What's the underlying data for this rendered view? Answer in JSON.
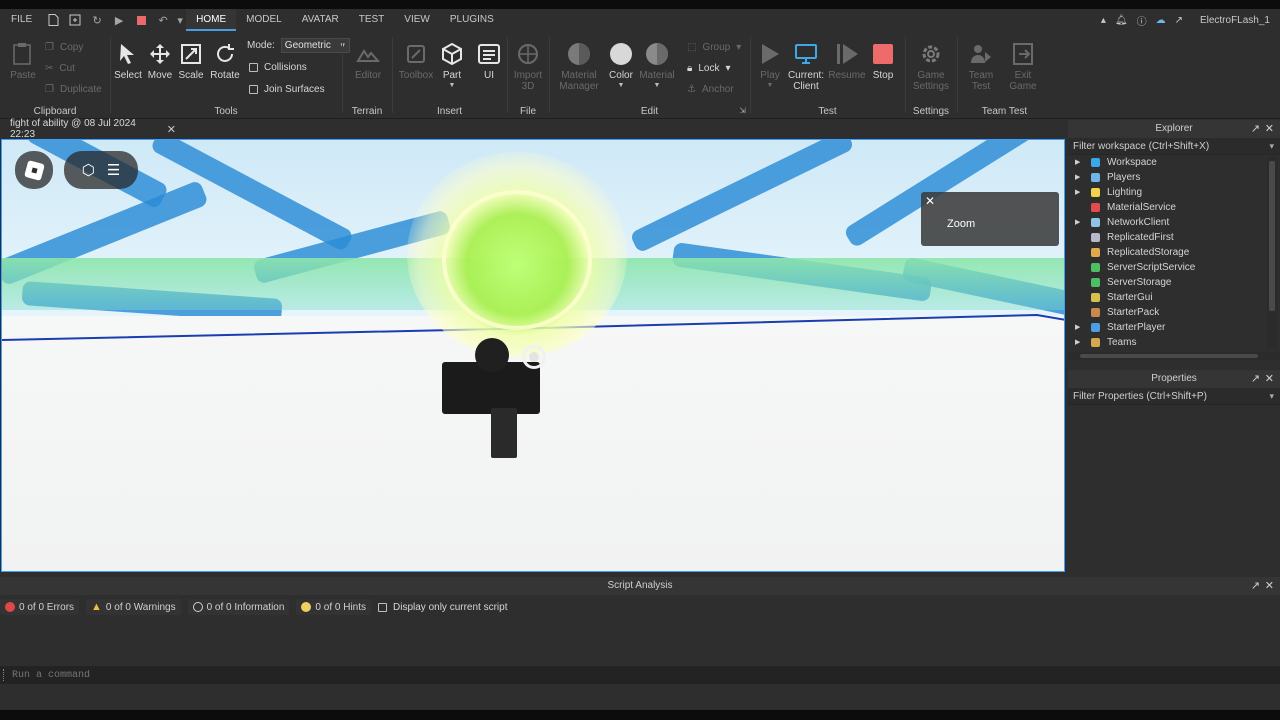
{
  "menubar": {
    "tabs": [
      "FILE",
      "HOME",
      "MODEL",
      "AVATAR",
      "TEST",
      "VIEW",
      "PLUGINS"
    ],
    "active_tab": "HOME",
    "username": "ElectroFLash_1"
  },
  "ribbon": {
    "clipboard": {
      "label": "Clipboard",
      "paste": "Paste",
      "copy": "Copy",
      "cut": "Cut",
      "duplicate": "Duplicate"
    },
    "tools": {
      "label": "Tools",
      "select": "Select",
      "move": "Move",
      "scale": "Scale",
      "rotate": "Rotate",
      "mode_label": "Mode:",
      "mode_value": "Geometric",
      "collisions": "Collisions",
      "join_surfaces": "Join Surfaces"
    },
    "terrain": {
      "label": "Terrain",
      "editor": "Editor"
    },
    "insert": {
      "label": "Insert",
      "toolbox": "Toolbox",
      "part": "Part",
      "ui": "UI"
    },
    "file": {
      "label": "File",
      "import_3d": "Import 3D"
    },
    "edit": {
      "label": "Edit",
      "material_manager": "Material Manager",
      "color": "Color",
      "material": "Material",
      "group": "Group",
      "lock": "Lock",
      "anchor": "Anchor"
    },
    "test": {
      "label": "Test",
      "play": "Play",
      "current_client": "Current: Client",
      "resume": "Resume",
      "stop": "Stop"
    },
    "settings": {
      "label": "Settings",
      "game_settings": "Game Settings"
    },
    "team_test": {
      "label": "Team Test",
      "team_test_btn": "Team Test",
      "exit_game": "Exit Game"
    }
  },
  "document_tab": {
    "title": "fight of ability @ 08 Jul 2024 22:23"
  },
  "viewport": {
    "zoom_popup": "Zoom"
  },
  "explorer": {
    "title": "Explorer",
    "filter_placeholder": "Filter workspace (Ctrl+Shift+X)",
    "items": [
      {
        "label": "Workspace",
        "expandable": true,
        "color": "#3aa7e8"
      },
      {
        "label": "Players",
        "expandable": true,
        "color": "#6fb6e8"
      },
      {
        "label": "Lighting",
        "expandable": true,
        "color": "#f2d34a"
      },
      {
        "label": "MaterialService",
        "expandable": false,
        "color": "#e24c4c"
      },
      {
        "label": "NetworkClient",
        "expandable": true,
        "color": "#8fc3e8"
      },
      {
        "label": "ReplicatedFirst",
        "expandable": false,
        "color": "#b9b9c9"
      },
      {
        "label": "ReplicatedStorage",
        "expandable": false,
        "color": "#e2a84c"
      },
      {
        "label": "ServerScriptService",
        "expandable": false,
        "color": "#4cbf63"
      },
      {
        "label": "ServerStorage",
        "expandable": false,
        "color": "#4cbf63"
      },
      {
        "label": "StarterGui",
        "expandable": false,
        "color": "#d6c14c"
      },
      {
        "label": "StarterPack",
        "expandable": false,
        "color": "#c78a4c"
      },
      {
        "label": "StarterPlayer",
        "expandable": true,
        "color": "#4c9ee0"
      },
      {
        "label": "Teams",
        "expandable": true,
        "color": "#d6a84c"
      }
    ]
  },
  "properties": {
    "title": "Properties",
    "filter_placeholder": "Filter Properties (Ctrl+Shift+P)"
  },
  "script_analysis": {
    "title": "Script Analysis",
    "errors": "0 of 0 Errors",
    "warnings": "0 of 0 Warnings",
    "information": "0 of 0 Information",
    "hints": "0 of 0 Hints",
    "display_only": "Display only current script"
  },
  "command_bar": {
    "placeholder": "Run a command"
  }
}
